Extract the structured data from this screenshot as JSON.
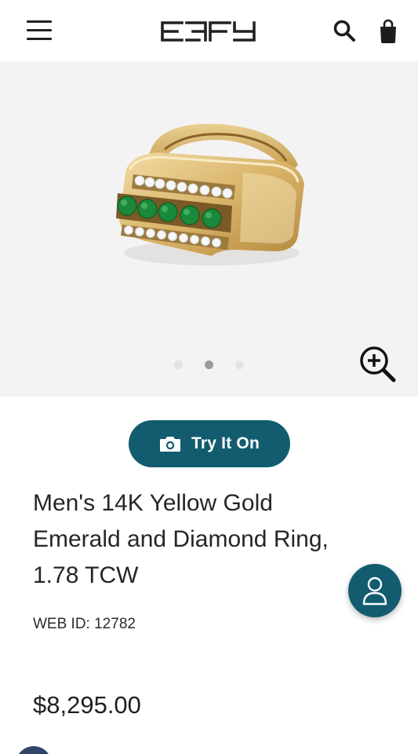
{
  "header": {
    "logo_text": "EFFY",
    "menu_icon": "hamburger-menu-icon",
    "search_icon": "search-icon",
    "bag_icon": "shopping-bag-icon"
  },
  "gallery": {
    "image_alt": "Men's 14K Yellow Gold Emerald and Diamond Ring",
    "slide_count": 3,
    "active_slide": 2,
    "zoom_icon": "zoom-in-icon"
  },
  "try_on": {
    "label": "Try It On",
    "icon": "camera-icon"
  },
  "product": {
    "title": "Men's 14K Yellow Gold Emerald and Diamond Ring, 1.78 TCW",
    "web_id": "WEB ID: 12782",
    "price": "$8,295.00"
  },
  "fab": {
    "icon": "account-user-icon"
  },
  "colors": {
    "brand_teal": "#135c6f",
    "gallery_bg": "#f4f3f3",
    "gold": "#d9b46a",
    "emerald": "#1a8a3a"
  }
}
